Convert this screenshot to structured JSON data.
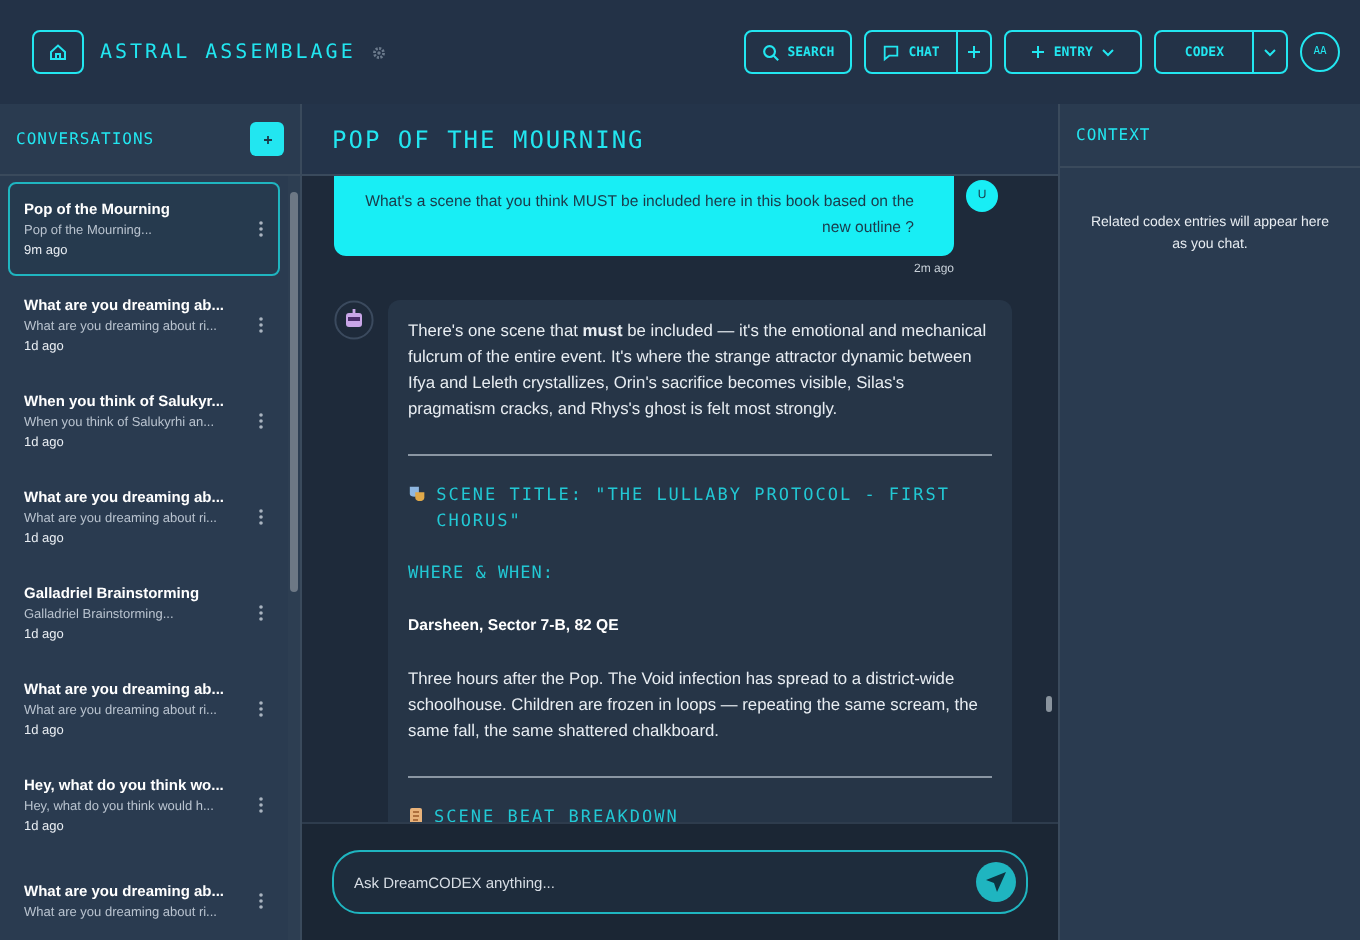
{
  "header": {
    "brand": "ASTRAL ASSEMBLAGE",
    "search": "SEARCH",
    "chat": "CHAT",
    "entry": "ENTRY",
    "codex": "CODEX",
    "avatar": "AA"
  },
  "conversations": {
    "title": "CONVERSATIONS",
    "items": [
      {
        "title": "Pop of the Mourning",
        "preview": "Pop of the Mourning...",
        "time": "9m ago",
        "selected": true
      },
      {
        "title": "What are you dreaming ab...",
        "preview": "What are you dreaming about ri...",
        "time": "1d ago",
        "selected": false
      },
      {
        "title": "When you think of Salukyr...",
        "preview": "When you think of Salukyrhi an...",
        "time": "1d ago",
        "selected": false
      },
      {
        "title": "What are you dreaming ab...",
        "preview": "What are you dreaming about ri...",
        "time": "1d ago",
        "selected": false
      },
      {
        "title": "Galladriel Brainstorming",
        "preview": "Galladriel Brainstorming...",
        "time": "1d ago",
        "selected": false
      },
      {
        "title": "What are you dreaming ab...",
        "preview": "What are you dreaming about ri...",
        "time": "1d ago",
        "selected": false
      },
      {
        "title": "Hey, what do you think wo...",
        "preview": "Hey, what do you think would h...",
        "time": "1d ago",
        "selected": false
      },
      {
        "title": "What are you dreaming ab...",
        "preview": "What are you dreaming about ri...",
        "selected": false
      }
    ]
  },
  "chat": {
    "title": "POP OF THE MOURNING",
    "user_message": {
      "text": "What's a scene that you think MUST be included here in this book based on the new outline ?",
      "avatar": "U",
      "time": "2m ago"
    },
    "reply": [
      {
        "kind": "paragraph",
        "text": "There's one scene that **must** be included — it's the emotional and mechanical fulcrum of the entire event. It's where the strange attractor dynamic between Ifya and Leleth crystallizes, Orin's sacrifice becomes visible, Silas's pragmatism cracks, and Rhys's ghost is felt most strongly."
      },
      {
        "kind": "rule"
      },
      {
        "kind": "title_heading",
        "text": "SCENE TITLE: \"THE LULLABY PROTOCOL - FIRST CHORUS\""
      },
      {
        "kind": "subheading",
        "text": "WHERE & WHEN:"
      },
      {
        "kind": "bold",
        "text": "Darsheen, Sector 7-B, 82 QE"
      },
      {
        "kind": "paragraph",
        "text": "Three hours after the Pop. The Void infection has spread to a district-wide schoolhouse. Children are frozen in loops — repeating the same scream, the same fall, the same shattered chalkboard."
      },
      {
        "kind": "rule"
      },
      {
        "kind": "beats_heading",
        "text": "SCENE BEAT BREAKDOWN"
      }
    ],
    "input": {
      "placeholder": "Ask DreamCODEX anything..."
    }
  },
  "context": {
    "title": "CONTEXT",
    "empty": "Related codex entries will appear here as you chat."
  }
}
